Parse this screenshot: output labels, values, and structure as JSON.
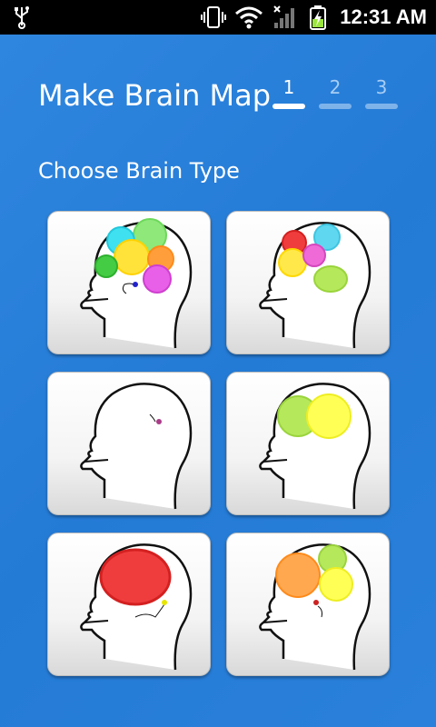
{
  "status_bar": {
    "time": "12:31 AM",
    "icons": [
      "usb-icon",
      "vibrate-icon",
      "wifi-icon",
      "signal-icon",
      "battery-charging-icon"
    ]
  },
  "header": {
    "title": "Make Brain Map",
    "steps": [
      {
        "label": "1",
        "active": true
      },
      {
        "label": "2",
        "active": false
      },
      {
        "label": "3",
        "active": false
      }
    ]
  },
  "section": {
    "subtitle": "Choose Brain Type"
  },
  "brain_types": [
    {
      "id": "brain-type-1",
      "colors": [
        "#8ee87a",
        "#3fe0f0",
        "#ffe33a",
        "#ffb050",
        "#ff9e3a",
        "#44cc44",
        "#e85fe8"
      ]
    },
    {
      "id": "brain-type-2",
      "colors": [
        "#ef3d3d",
        "#5fd7f0",
        "#ffe94a",
        "#ef6ad7",
        "#b6e85c"
      ]
    },
    {
      "id": "brain-type-3",
      "colors": []
    },
    {
      "id": "brain-type-4",
      "colors": [
        "#b6e85c",
        "#ffff55"
      ]
    },
    {
      "id": "brain-type-5",
      "colors": [
        "#ef3d3d"
      ]
    },
    {
      "id": "brain-type-6",
      "colors": [
        "#ffa850",
        "#b6e85c",
        "#ffff55"
      ]
    }
  ],
  "accent_colors": {
    "background": "#2a7fd8",
    "step_active": "#ffffff",
    "step_inactive": "#7eb3ea"
  }
}
